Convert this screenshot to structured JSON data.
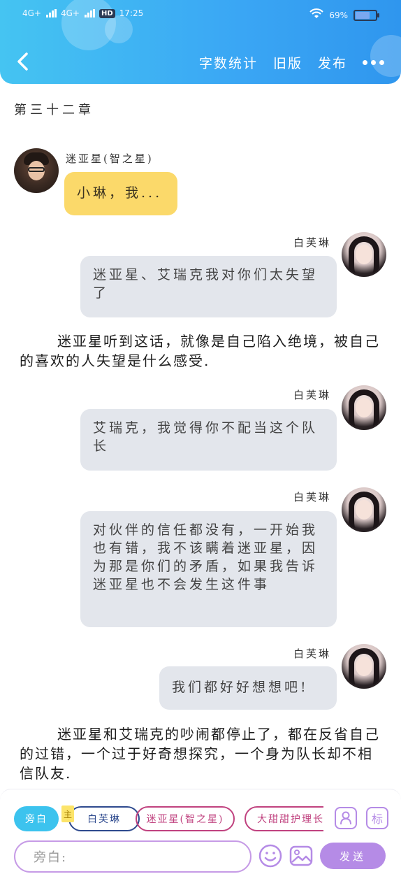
{
  "status_bar": {
    "time": "17:25",
    "network1": "4G+",
    "network2": "4G+",
    "hd": "HD",
    "battery": "69%"
  },
  "header": {
    "word_count": "字数统计",
    "old_version": "旧版",
    "publish": "发布"
  },
  "chapter_title": "第三十二章",
  "messages": [
    {
      "speaker": "迷亚星(智之星)",
      "side": "left",
      "text": "小琳，我..."
    },
    {
      "speaker": "白芙琳",
      "side": "right",
      "text": "迷亚星、艾瑞克我对你们太失望了"
    },
    {
      "speaker": "白芙琳",
      "side": "right",
      "text": "艾瑞克，我觉得你不配当这个队长"
    },
    {
      "speaker": "白芙琳",
      "side": "right",
      "text": "对伙伴的信任都没有，一开始我也有错，我不该瞒着迷亚星，因为那是你们的矛盾，如果我告诉迷亚星也不会发生这件事"
    },
    {
      "speaker": "白芙琳",
      "side": "right",
      "text": "我们都好好想想吧!"
    }
  ],
  "narrations": [
    "迷亚星听到这话，就像是自己陷入绝境，被自己的喜欢的人失望是什么感受.",
    "迷亚星和艾瑞克的吵闹都停止了，都在反省自己的过错，一个过于好奇想探究，一个身为队长却不相信队友."
  ],
  "composer": {
    "chips": [
      "旁白",
      "白芙琳",
      "迷亚星(智之星)",
      "大甜甜护理长"
    ],
    "main_tag": "主",
    "input_placeholder": "旁白:",
    "send": "发送",
    "tag_button": "标"
  },
  "colors": {
    "header_blue": "#3aa6f4",
    "accent_purple": "#b58be6",
    "left_bubble": "#fbd96a",
    "right_bubble": "#e3e6ec"
  }
}
